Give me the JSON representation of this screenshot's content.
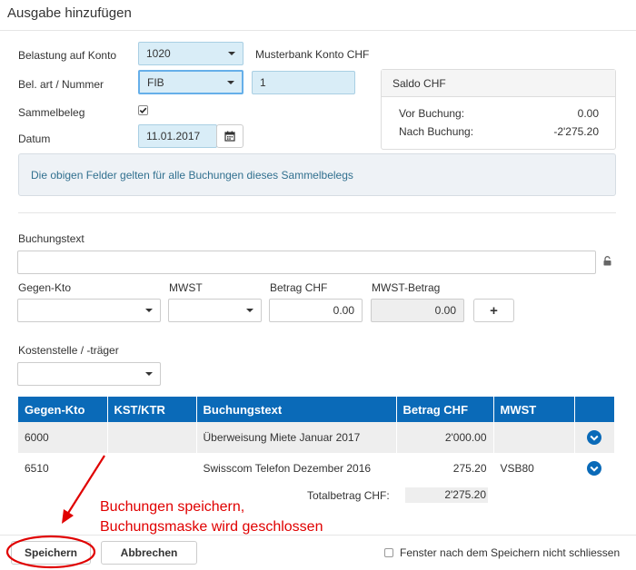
{
  "dialog": {
    "title": "Ausgabe hinzufügen"
  },
  "form": {
    "belastung_label": "Belastung auf Konto",
    "belastung_value": "1020",
    "belastung_name": "Musterbank Konto CHF",
    "belart_label": "Bel. art / Nummer",
    "belart_value": "FIB",
    "nummer_value": "1",
    "sammelbeleg_label": "Sammelbeleg",
    "sammelbeleg_checked": true,
    "datum_label": "Datum",
    "datum_value": "11.01.2017"
  },
  "saldo": {
    "title": "Saldo CHF",
    "vor_label": "Vor Buchung:",
    "vor_value": "0.00",
    "nach_label": "Nach Buchung:",
    "nach_value": "-2'275.20"
  },
  "info_text": "Die obigen Felder gelten für alle Buchungen dieses Sammelbelegs",
  "entry": {
    "buchungstext_label": "Buchungstext",
    "buchungstext_value": "",
    "gegenkto_label": "Gegen-Kto",
    "mwst_label": "MWST",
    "betrag_label": "Betrag CHF",
    "betrag_value": "0.00",
    "mwstbetrag_label": "MWST-Betrag",
    "mwstbetrag_value": "0.00",
    "add_label": "+",
    "kostenstelle_label": "Kostenstelle / -träger"
  },
  "table": {
    "headers": [
      "Gegen-Kto",
      "KST/KTR",
      "Buchungstext",
      "Betrag CHF",
      "MWST",
      ""
    ],
    "rows": [
      {
        "gegenkto": "6000",
        "kst": "",
        "text": "Überweisung Miete Januar 2017",
        "betrag": "2'000.00",
        "mwst": ""
      },
      {
        "gegenkto": "6510",
        "kst": "",
        "text": "Swisscom Telefon Dezember 2016",
        "betrag": "275.20",
        "mwst": "VSB80"
      }
    ],
    "total_label": "Totalbetrag CHF:",
    "total_value": "2'275.20"
  },
  "annotation": {
    "line1": "Buchungen speichern,",
    "line2": "Buchungsmaske wird geschlossen",
    "color": "#e00000"
  },
  "footer": {
    "save_label": "Speichern",
    "cancel_label": "Abbrechen",
    "keep_open_label": "Fenster nach dem Speichern nicht schliessen"
  },
  "colors": {
    "accent": "#0a6ab8",
    "field_fill": "#d9edf7",
    "info_text": "#31708f"
  },
  "icons": {
    "calendar": "calendar-icon",
    "lock": "lock-icon",
    "chevron": "chevron-down-circle-icon",
    "check": "checkmark-icon"
  }
}
